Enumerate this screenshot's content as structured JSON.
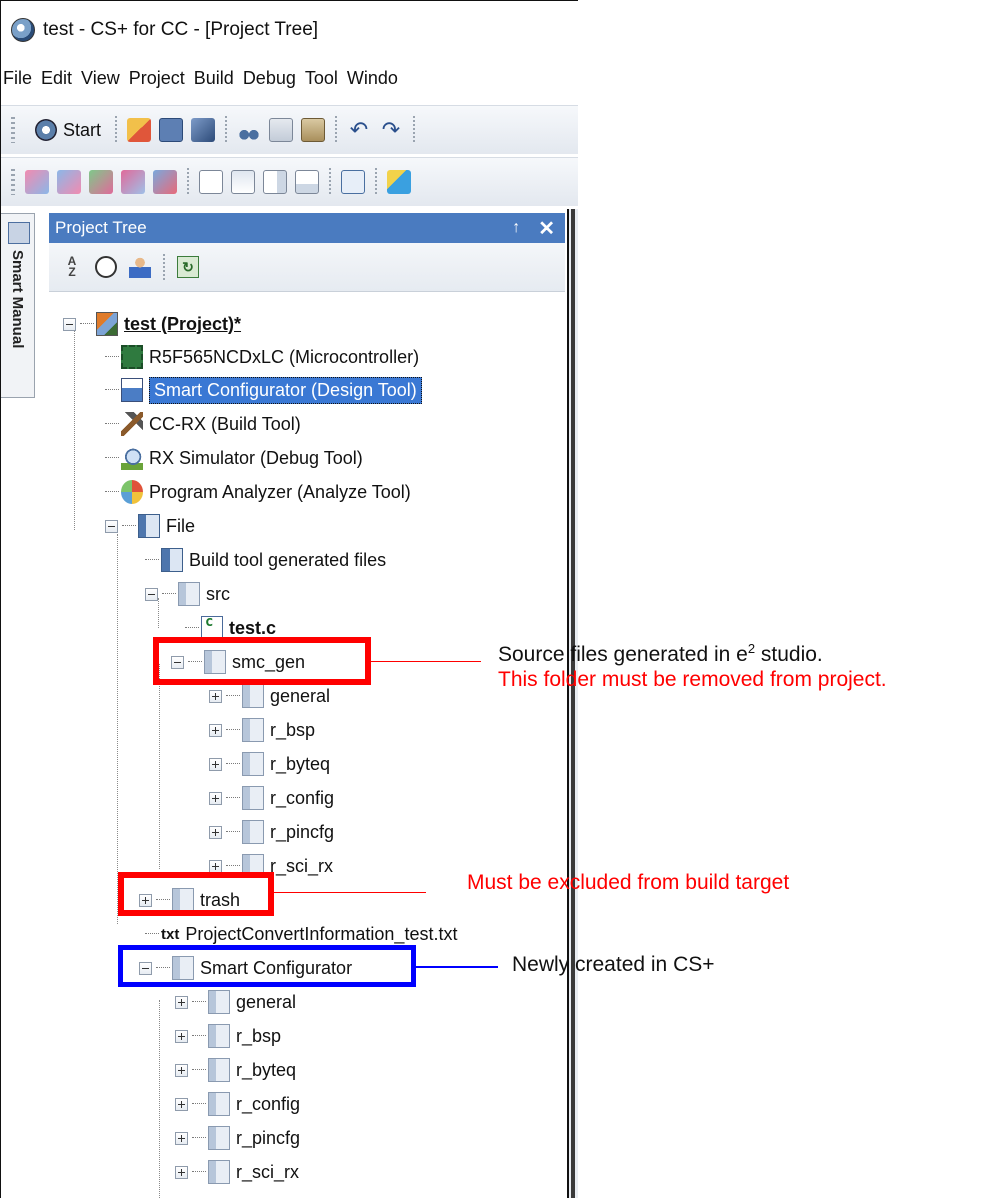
{
  "window": {
    "title": "test - CS+ for CC - [Project Tree]"
  },
  "menu": [
    "File",
    "Edit",
    "View",
    "Project",
    "Build",
    "Debug",
    "Tool",
    "Windo"
  ],
  "toolbar": {
    "start_label": "Start"
  },
  "side_tab": {
    "label": "Smart Manual"
  },
  "panel": {
    "title": "Project Tree",
    "pin": "↑",
    "close": "✕"
  },
  "tree": {
    "project": "test (Project)*",
    "microcontroller": "R5F565NCDxLC (Microcontroller)",
    "smart_configurator_tool": "Smart Configurator (Design Tool)",
    "build_tool": "CC-RX (Build Tool)",
    "debug_tool": "RX Simulator (Debug Tool)",
    "analyze_tool": "Program Analyzer (Analyze Tool)",
    "file": "File",
    "build_generated": "Build tool generated files",
    "src": "src",
    "test_c": "test.c",
    "smc_gen": "smc_gen",
    "smc_gen_children": [
      "general",
      "r_bsp",
      "r_byteq",
      "r_config",
      "r_pincfg",
      "r_sci_rx"
    ],
    "trash": "trash",
    "convert_info": "ProjectConvertInformation_test.txt",
    "txt_badge": "txt",
    "smart_configurator": "Smart Configurator",
    "smart_configurator_children": [
      "general",
      "r_bsp",
      "r_byteq",
      "r_config",
      "r_pincfg",
      "r_sci_rx"
    ]
  },
  "annotations": {
    "smc_gen_line1_pre": "Source files generated in e",
    "smc_gen_line1_sup": "2",
    "smc_gen_line1_post": " studio.",
    "smc_gen_line2": "This folder must be removed from project.",
    "trash_note": "Must be excluded from build target",
    "smart_config_note": "Newly created in CS+"
  },
  "colors": {
    "highlight_red": "#ff0000",
    "highlight_blue": "#0000ff",
    "selection": "#3a78d4",
    "panel_header": "#4a7bc0"
  }
}
